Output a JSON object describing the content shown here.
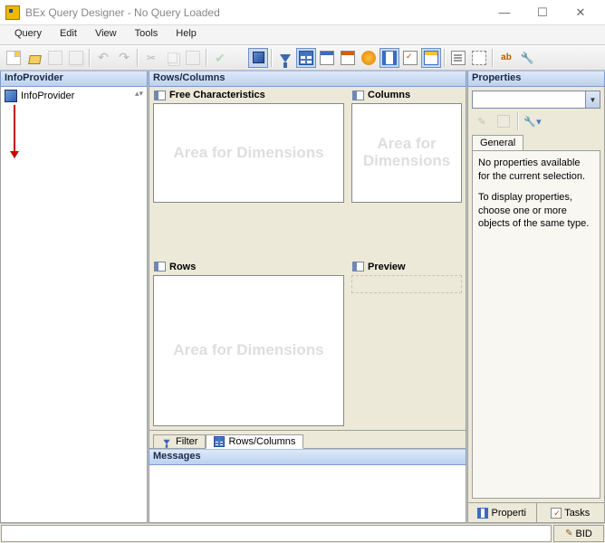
{
  "titlebar": {
    "title": "BEx Query Designer - No Query Loaded"
  },
  "menu": {
    "query": "Query",
    "edit": "Edit",
    "view": "View",
    "tools": "Tools",
    "help": "Help"
  },
  "panels": {
    "infoprovider_head": "InfoProvider",
    "infoprovider_root": "InfoProvider",
    "rowscols_head": "Rows/Columns",
    "free_chars": "Free Characteristics",
    "columns": "Columns",
    "rows": "Rows",
    "preview": "Preview",
    "watermark": "Area for Dimensions",
    "props_head": "Properties",
    "messages_head": "Messages"
  },
  "tabs": {
    "filter": "Filter",
    "rowscols": "Rows/Columns",
    "general": "General",
    "properties": "Properti",
    "tasks": "Tasks"
  },
  "props_text": {
    "line1": "No properties available for the current selection.",
    "line2": "To display properties, choose one or more objects of the same type."
  },
  "status": {
    "system": "BID"
  }
}
